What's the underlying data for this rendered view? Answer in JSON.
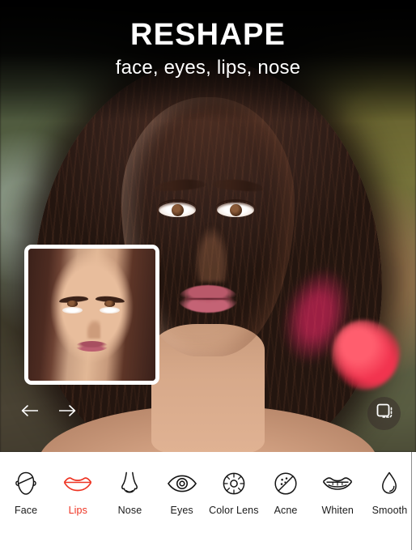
{
  "header": {
    "title": "RESHAPE",
    "subtitle": "face, eyes, lips, nose"
  },
  "colors": {
    "accent": "#ee3322",
    "toolbar_background": "#ffffff",
    "label": "#1b1b1b",
    "overlay_button": "rgba(55,45,42,0.52)"
  },
  "canvas": {
    "thumbnail": {
      "name": "face-preview-thumbnail",
      "border_color": "#ffffff"
    },
    "controls": {
      "undo": "arrow-left-icon",
      "redo": "arrow-right-icon",
      "compare": "compare-before-after-icon"
    }
  },
  "toolbar": {
    "selected": "Lips",
    "items": [
      {
        "label": "Face",
        "icon": "face-outline-icon",
        "selected": false
      },
      {
        "label": "Lips",
        "icon": "lips-icon",
        "selected": true
      },
      {
        "label": "Nose",
        "icon": "nose-icon",
        "selected": false
      },
      {
        "label": "Eyes",
        "icon": "eye-icon",
        "selected": false
      },
      {
        "label": "Color\nLens",
        "icon": "color-lens-icon",
        "selected": false
      },
      {
        "label": "Acne",
        "icon": "acne-icon",
        "selected": false
      },
      {
        "label": "Whiten",
        "icon": "whiten-teeth-icon",
        "selected": false
      },
      {
        "label": "Smooth",
        "icon": "droplet-icon",
        "selected": false
      }
    ]
  }
}
